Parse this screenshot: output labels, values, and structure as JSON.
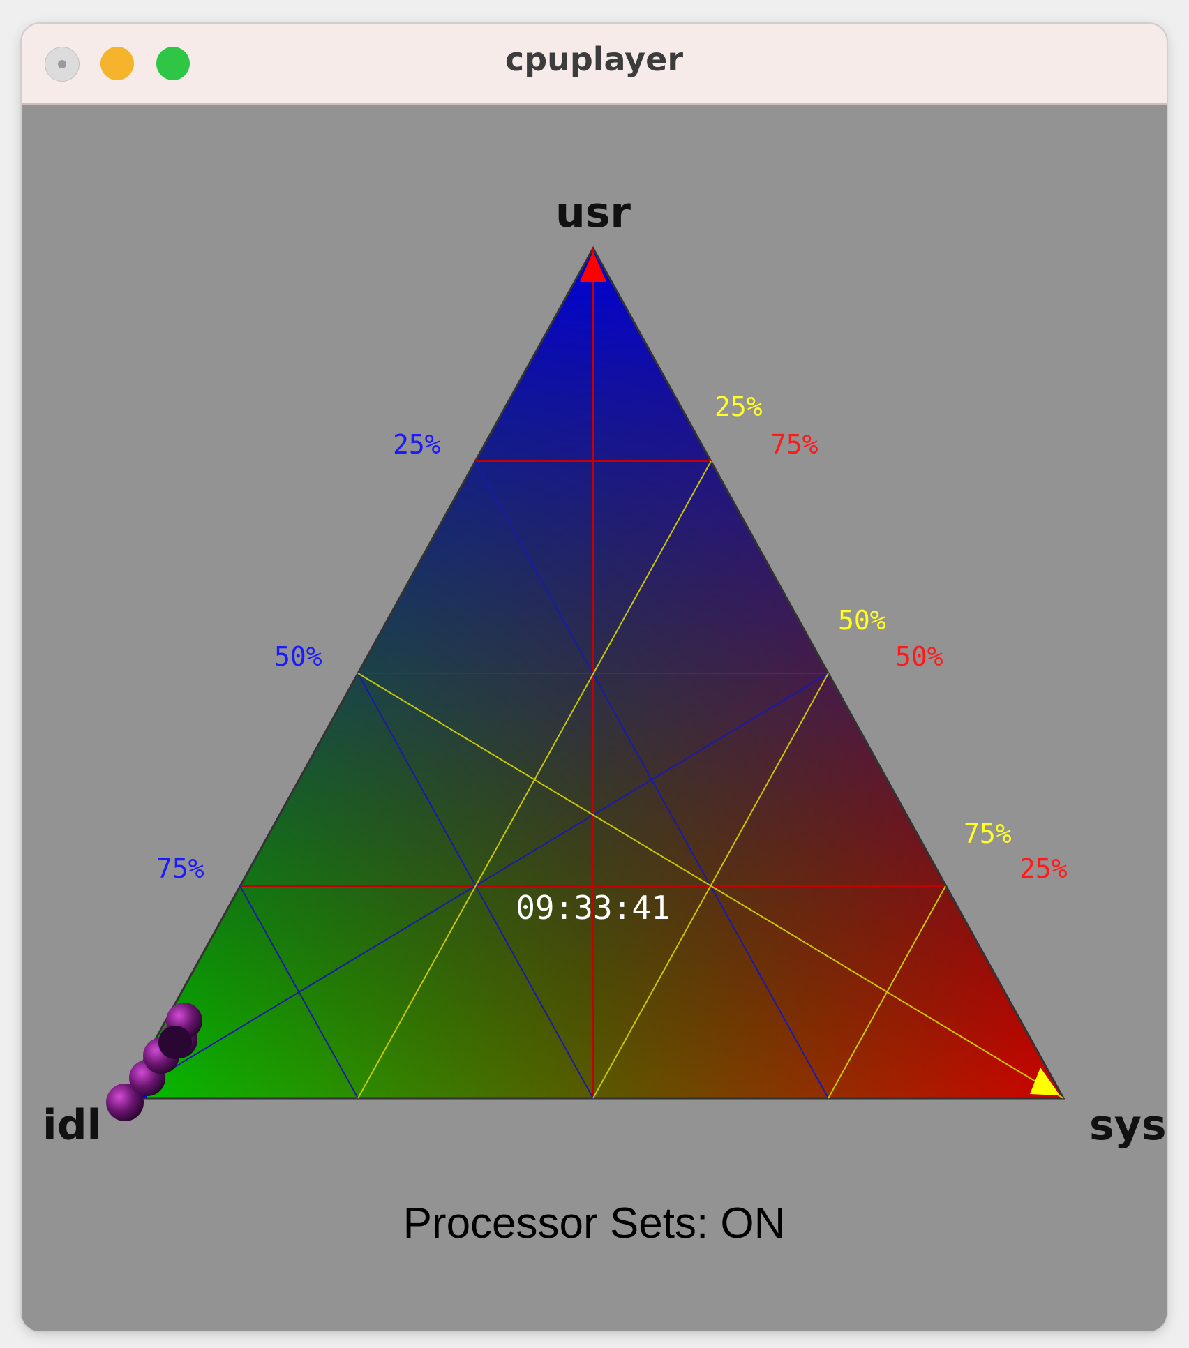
{
  "window": {
    "title": "cpuplayer"
  },
  "plot": {
    "vertex_labels": {
      "top": "usr",
      "left": "idl",
      "right": "sys"
    },
    "usr_scale": [
      "25%",
      "50%",
      "75%"
    ],
    "sys_scale": [
      "25%",
      "50%",
      "75%"
    ],
    "idl_scale": [
      "75%",
      "50%",
      "25%"
    ],
    "clock": "09:33:41",
    "colors": {
      "usr": "#0000ff",
      "sys": "#ff0000",
      "idl": "#00cc00",
      "usr_label": "#1a1aff",
      "sys_label": "#ffff22",
      "idl_label": "#ff1a1a",
      "trail": "#7a1a8a"
    }
  },
  "status": {
    "text": "Processor Sets: ON"
  }
}
